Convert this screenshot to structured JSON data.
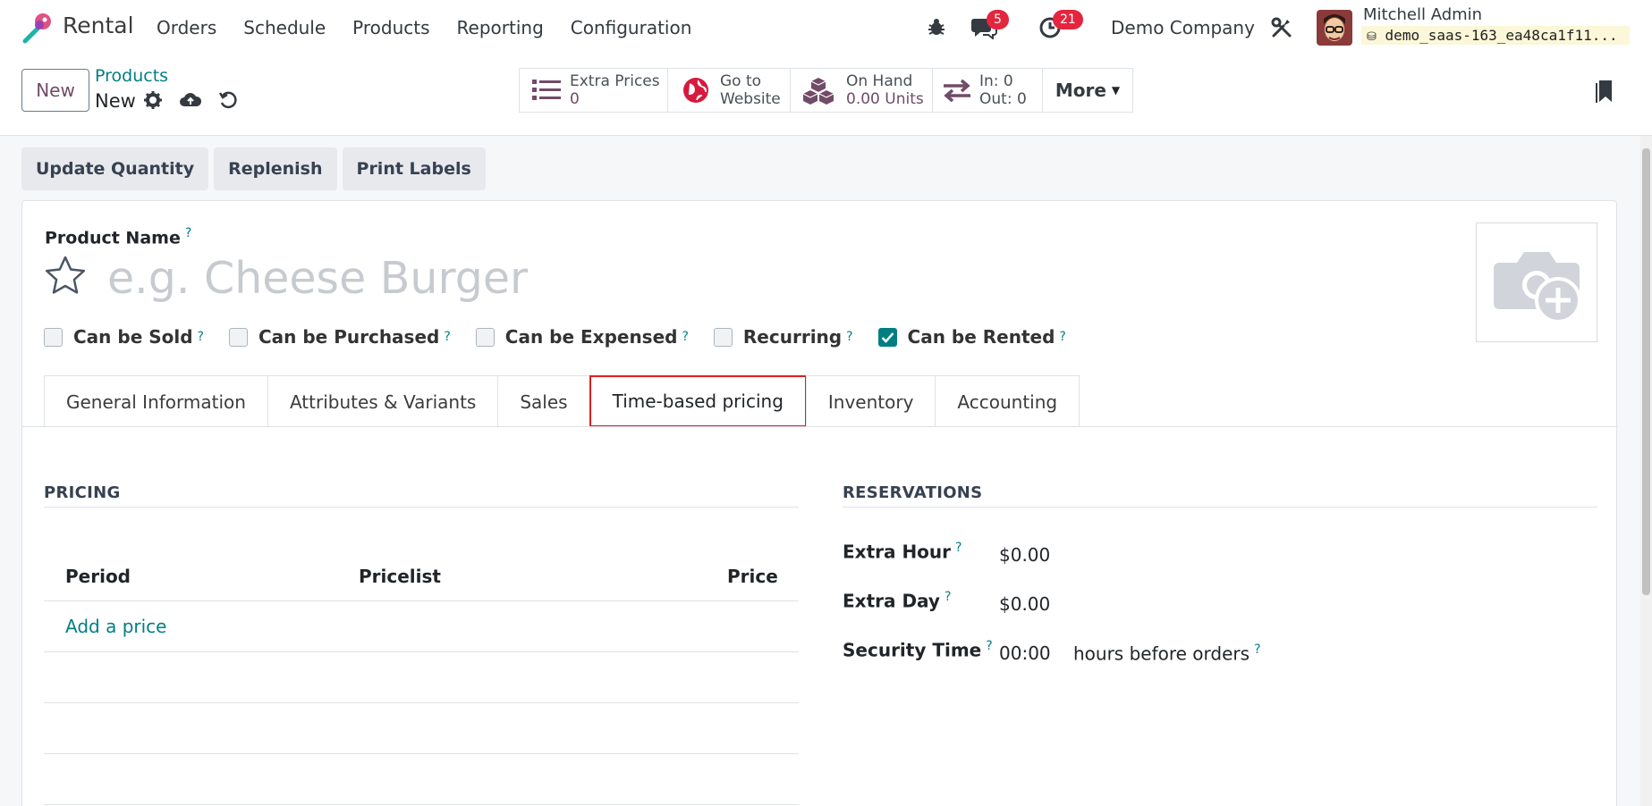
{
  "navbar": {
    "app_name": "Rental",
    "menu": [
      "Orders",
      "Schedule",
      "Products",
      "Reporting",
      "Configuration"
    ],
    "messages_count": "5",
    "activities_count": "21",
    "company": "Demo Company",
    "user_name": "Mitchell Admin",
    "database": "demo_saas-163_ea48ca1f11..."
  },
  "control": {
    "new_label": "New",
    "breadcrumb_parent": "Products",
    "breadcrumb_current": "New",
    "smart_buttons": {
      "extra_prices": {
        "label": "Extra Prices",
        "value": "0"
      },
      "website": {
        "line1": "Go to",
        "line2": "Website"
      },
      "on_hand": {
        "label": "On Hand",
        "value": "0.00 Units"
      },
      "in_out": {
        "in": "In: 0",
        "out": "Out: 0"
      },
      "more": "More"
    }
  },
  "actions": [
    "Update Quantity",
    "Replenish",
    "Print Labels"
  ],
  "form": {
    "product_name_label": "Product Name",
    "product_name_placeholder": "e.g. Cheese Burger",
    "checkboxes": [
      {
        "label": "Can be Sold",
        "checked": false
      },
      {
        "label": "Can be Purchased",
        "checked": false
      },
      {
        "label": "Can be Expensed",
        "checked": false
      },
      {
        "label": "Recurring",
        "checked": false
      },
      {
        "label": "Can be Rented",
        "checked": true
      }
    ],
    "tabs": [
      "General Information",
      "Attributes & Variants",
      "Sales",
      "Time-based pricing",
      "Inventory",
      "Accounting"
    ],
    "active_tab": "Time-based pricing"
  },
  "pricing": {
    "title": "PRICING",
    "columns": [
      "Period",
      "Pricelist",
      "Price"
    ],
    "add_label": "Add a price"
  },
  "reservations": {
    "title": "RESERVATIONS",
    "extra_hour_label": "Extra Hour",
    "extra_hour_value": "$0.00",
    "extra_day_label": "Extra Day",
    "extra_day_value": "$0.00",
    "security_time_label": "Security Time",
    "security_time_value": "00:00",
    "security_time_suffix": "hours before orders"
  },
  "help_mark": "?",
  "colors": {
    "brand": "#714b67",
    "accent": "#017e84",
    "badge": "#e4253e",
    "highlight": "#e11d1d"
  }
}
